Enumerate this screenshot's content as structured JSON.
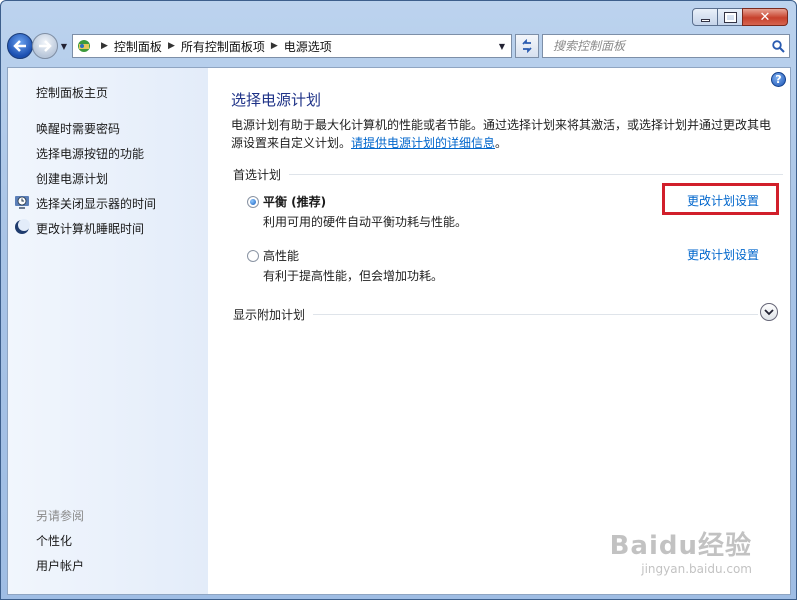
{
  "titlebar": {
    "minimize_icon": "minimize-icon",
    "maximize_icon": "maximize-icon",
    "close_icon": "close-icon"
  },
  "navigation": {
    "breadcrumbs": [
      "控制面板",
      "所有控制面板项",
      "电源选项"
    ],
    "search_placeholder": "搜索控制面板"
  },
  "sidebar": {
    "items": [
      {
        "label": "控制面板主页"
      },
      {
        "label": "唤醒时需要密码"
      },
      {
        "label": "选择电源按钮的功能"
      },
      {
        "label": "创建电源计划"
      },
      {
        "label": "选择关闭显示器的时间",
        "icon": "display-clock-icon"
      },
      {
        "label": "更改计算机睡眠时间",
        "icon": "moon-icon"
      }
    ],
    "see_also": {
      "heading": "另请参阅",
      "items": [
        {
          "label": "个性化"
        },
        {
          "label": "用户帐户"
        }
      ]
    }
  },
  "main": {
    "title": "选择电源计划",
    "description": "电源计划有助于最大化计算机的性能或者节能。通过选择计划来将其激活，或选择计划并通过更改其电源设置来自定义计划。",
    "description_link": "请提供电源计划的详细信息",
    "description_end": "。",
    "preferred_heading": "首选计划",
    "plans": [
      {
        "name": "平衡 (推荐)",
        "description": "利用可用的硬件自动平衡功耗与性能。",
        "change_link": "更改计划设置",
        "selected": true
      },
      {
        "name": "高性能",
        "description": "有利于提高性能，但会增加功耗。",
        "change_link": "更改计划设置",
        "selected": false
      }
    ],
    "additional_heading": "显示附加计划"
  },
  "watermark": {
    "big": "Baidu经验",
    "small": "jingyan.baidu.com"
  },
  "colors": {
    "title": "#1e3287",
    "link": "#0066cc",
    "highlight": "#d11f2a"
  }
}
